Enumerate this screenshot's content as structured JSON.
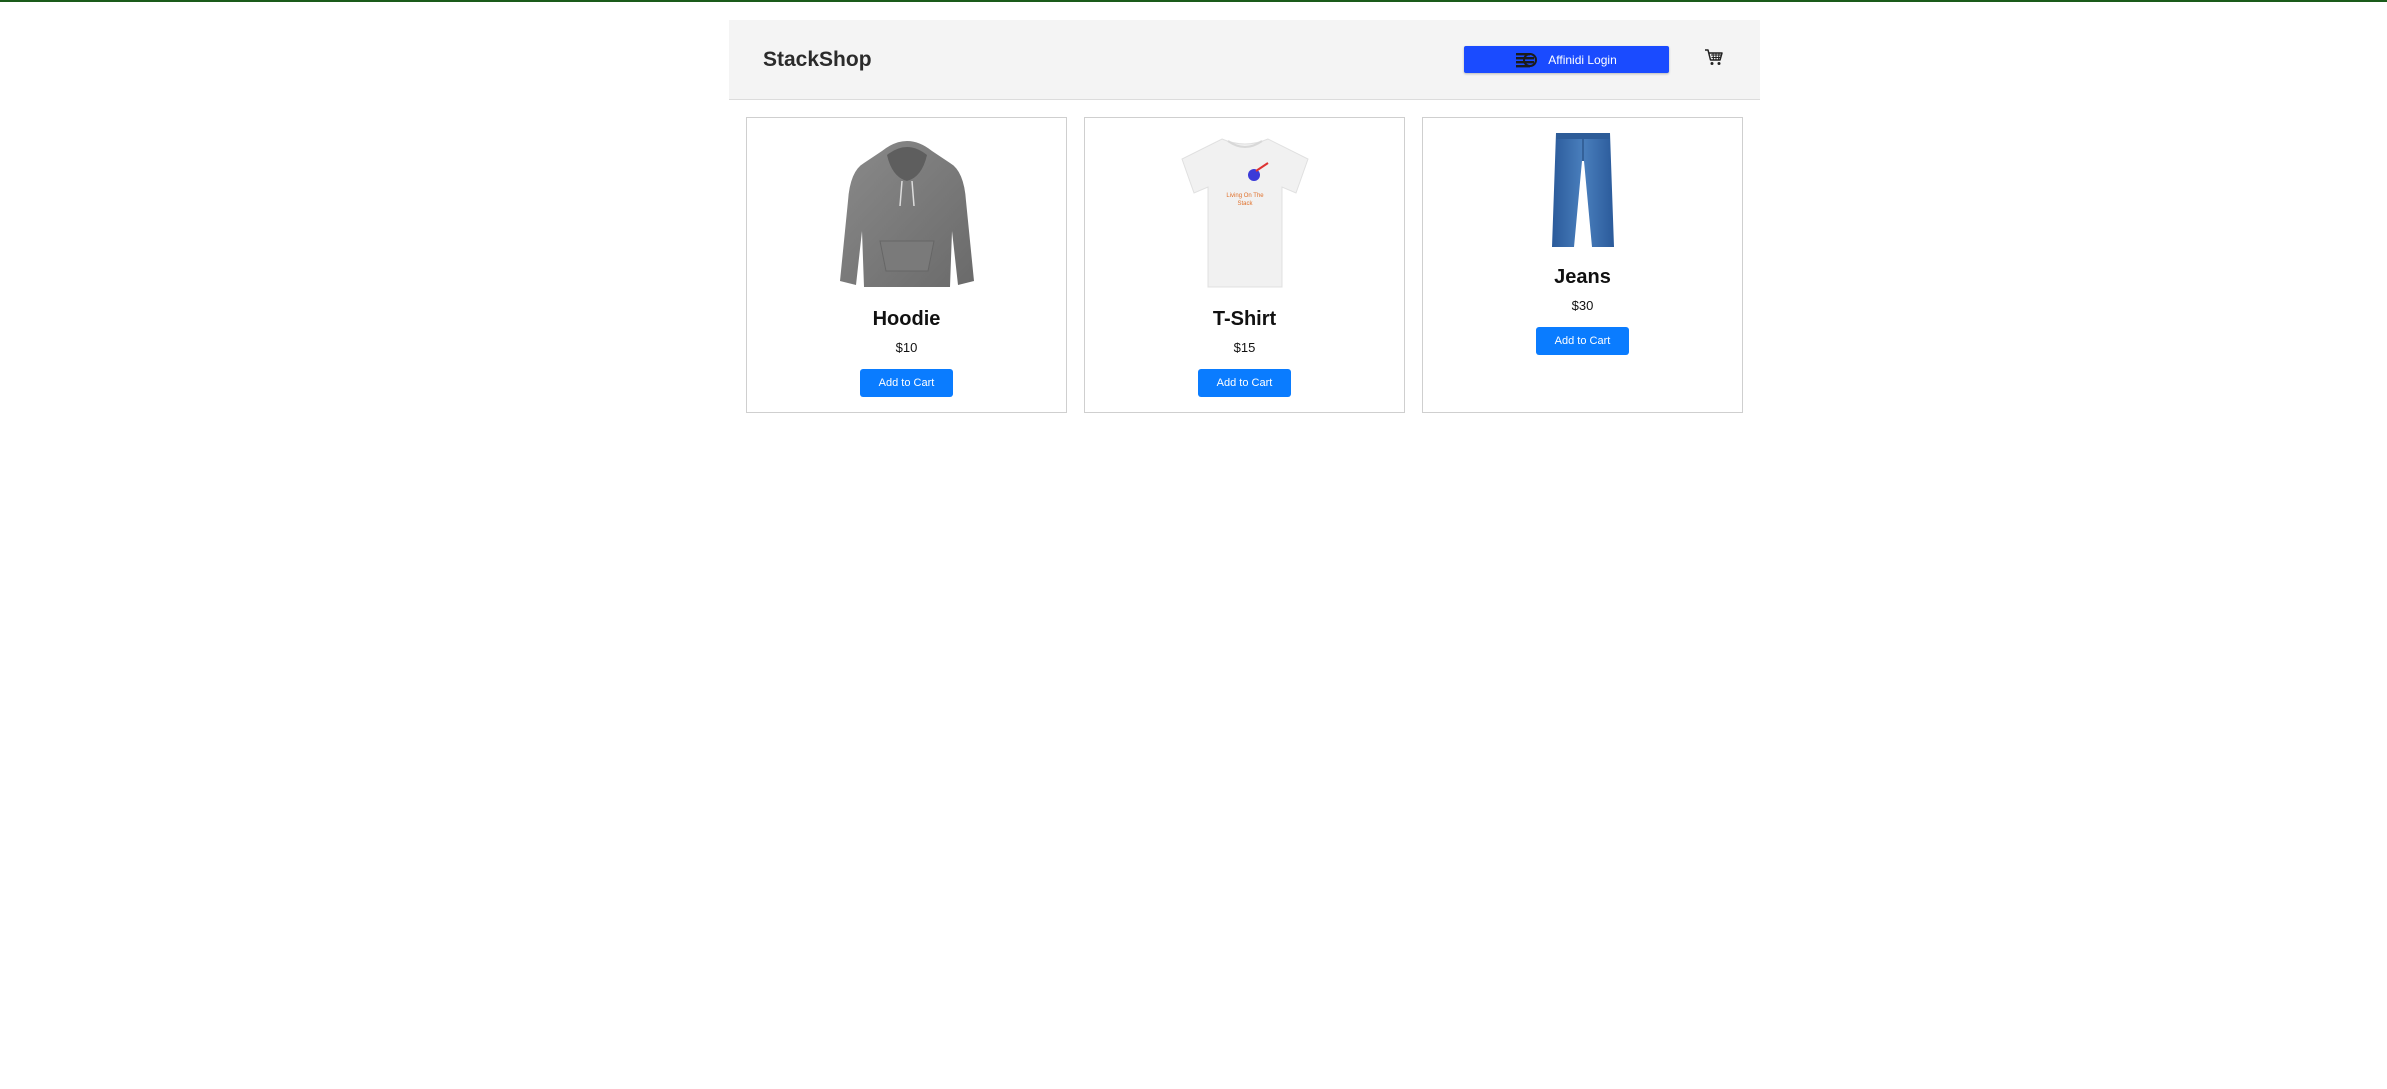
{
  "header": {
    "brand": "StackShop",
    "login_label": "Affinidi Login",
    "login_icon": "affinidi-logo-icon",
    "cart_icon": "shopping-cart-icon"
  },
  "colors": {
    "header_bg": "#f4f4f4",
    "login_button": "#1a4bff",
    "add_to_cart_button": "#0a7cff",
    "top_rule": "#1a5b1a"
  },
  "products": [
    {
      "name": "Hoodie",
      "price": "$10",
      "button": "Add to Cart",
      "image": "grey-hoodie"
    },
    {
      "name": "T-Shirt",
      "price": "$15",
      "button": "Add to Cart",
      "image": "white-tshirt",
      "print_text": "Living On The Stack"
    },
    {
      "name": "Jeans",
      "price": "$30",
      "button": "Add to Cart",
      "image": "blue-jeans"
    }
  ]
}
